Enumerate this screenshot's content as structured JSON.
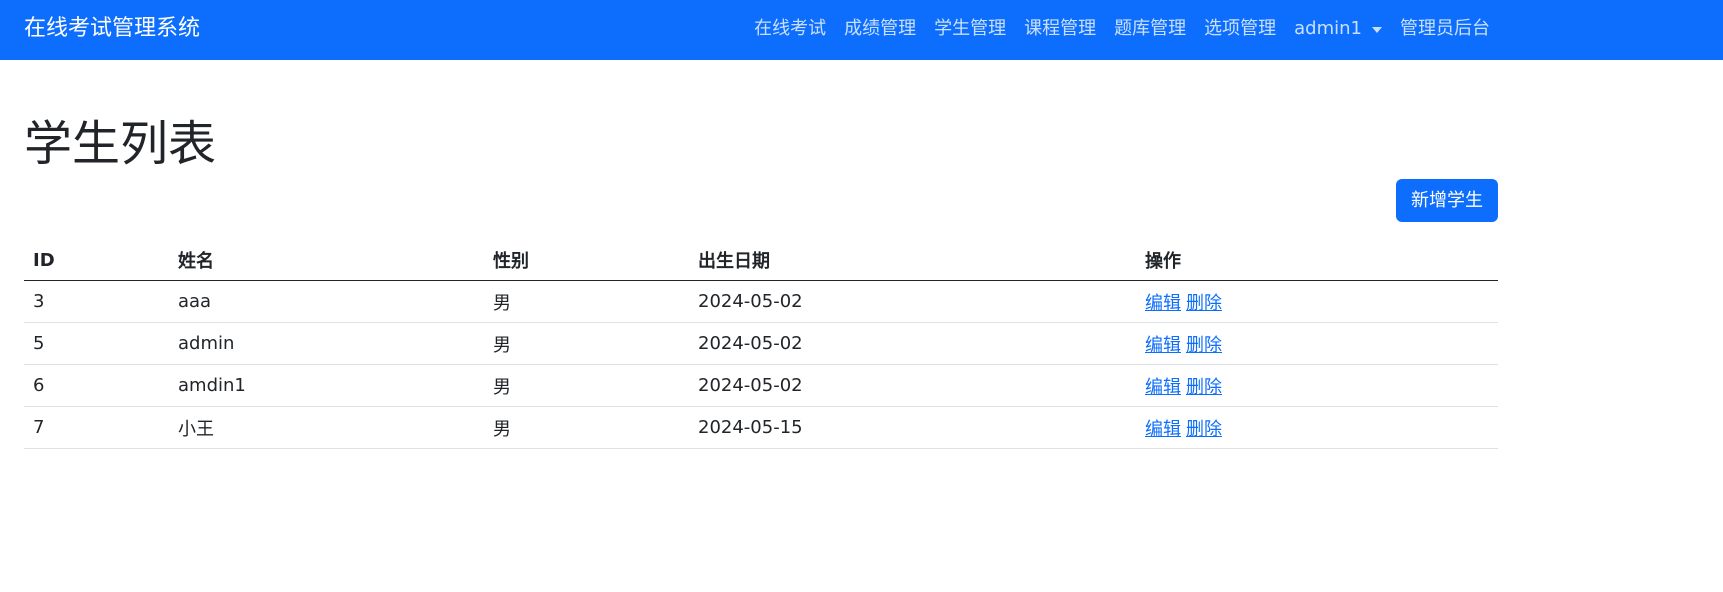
{
  "navbar": {
    "brand": "在线考试管理系统",
    "links": [
      "在线考试",
      "成绩管理",
      "学生管理",
      "课程管理",
      "题库管理",
      "选项管理"
    ],
    "user_menu": "admin1",
    "admin_link": "管理员后台"
  },
  "main": {
    "title": "学生列表",
    "add_button": "新增学生"
  },
  "table": {
    "headers": [
      "ID",
      "姓名",
      "性别",
      "出生日期",
      "操作"
    ],
    "rows": [
      {
        "id": "3",
        "name": "aaa",
        "gender": "男",
        "birth": "2024-05-02"
      },
      {
        "id": "5",
        "name": "admin",
        "gender": "男",
        "birth": "2024-05-02"
      },
      {
        "id": "6",
        "name": "amdin1",
        "gender": "男",
        "birth": "2024-05-02"
      },
      {
        "id": "7",
        "name": "小王",
        "gender": "男",
        "birth": "2024-05-15"
      }
    ],
    "edit_label": "编辑",
    "delete_label": "删除"
  },
  "colors": {
    "primary": "#0d6efd",
    "text": "#212529",
    "border": "#dee2e6"
  }
}
